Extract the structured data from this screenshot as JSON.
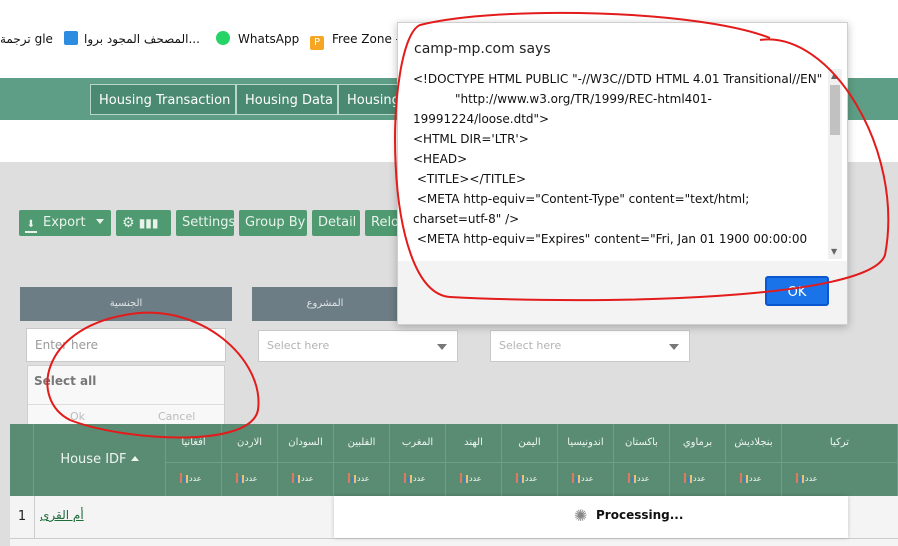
{
  "bookmarks": [
    {
      "label": "ترجمة",
      "icon": "translate-icon"
    },
    {
      "label": "gle",
      "icon": ""
    },
    {
      "label": "المصحف المجود بروا...",
      "icon": "quran-icon"
    },
    {
      "label": "WhatsApp",
      "icon": "whatsapp-icon"
    },
    {
      "label": "Free Zone -",
      "icon": "freezone-icon"
    }
  ],
  "nav": {
    "tabs": [
      "Housing Transaction",
      "Housing Data",
      "Housing"
    ]
  },
  "toolbar": {
    "export_label": "Export",
    "settings_label": "Settings",
    "groupby_label": "Group By",
    "detail_label": "Detail",
    "reload_label": "Relo"
  },
  "filters": {
    "nationality_header": "الجنسية",
    "project_header": "المشروع",
    "enter_placeholder": "Enter here",
    "select_placeholder_1": "Select here",
    "select_placeholder_2": "Select here",
    "select_all": "Select all",
    "ok": "Ok",
    "cancel": "Cancel"
  },
  "table": {
    "house_idf_header": "House IDF",
    "country_headers": [
      "افغانيا",
      "الاردن",
      "السودان",
      "الفلبين",
      "المغرب",
      "الهند",
      "اليمن",
      "اندونيسيا",
      "باكستان",
      "برماوي",
      "بنجلاديش",
      "تركيا"
    ],
    "count_label": "عدد",
    "row_number": "1",
    "row_name": "أم القرى"
  },
  "dialog": {
    "title": "camp-mp.com says",
    "body": "<!DOCTYPE HTML PUBLIC \"-//W3C//DTD HTML 4.01 Transitional//EN\"\n           \"http://www.w3.org/TR/1999/REC-html401-19991224/loose.dtd\">\n<HTML DIR='LTR'>\n<HEAD>\n <TITLE></TITLE>\n <META http-equiv=\"Content-Type\" content=\"text/html; charset=utf-8\" />\n <META http-equiv=\"Expires\" content=\"Fri, Jan 01 1900 00:00:00",
    "ok_label": "OK"
  },
  "processing": {
    "label": "Processing..."
  },
  "colors": {
    "nav_green": "#5f9e86",
    "toolbar_green": "#4f9a71",
    "header_green": "#5a8c73",
    "ok_blue": "#1a73e8",
    "annotation_red": "#e31b1b"
  }
}
